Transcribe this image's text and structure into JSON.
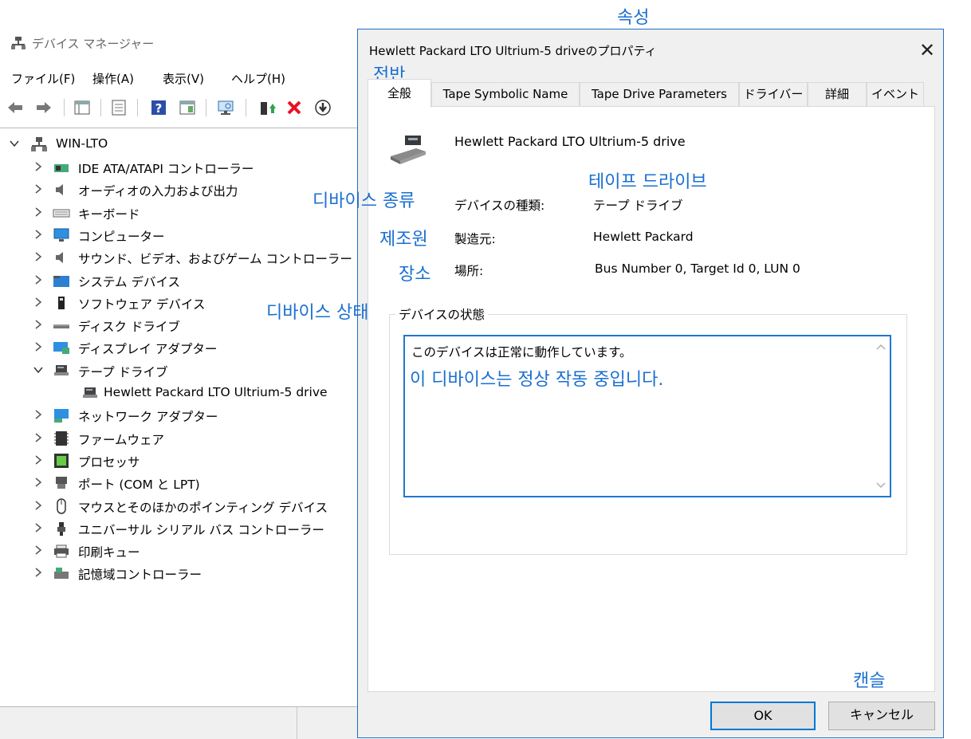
{
  "device_manager": {
    "title": "デバイス マネージャー",
    "menu": [
      "ファイル(F)",
      "操作(A)",
      "表示(V)",
      "ヘルプ(H)"
    ],
    "toolbar_icons": [
      "back-arrow-icon",
      "forward-arrow-icon",
      "properties-grid-icon",
      "update-driver-icon",
      "help-icon",
      "action-view-icon",
      "scan-hardware-icon",
      "enable-device-icon",
      "uninstall-x-icon",
      "disable-device-icon"
    ],
    "tree": {
      "root": "WIN-LTO",
      "items": [
        {
          "label": "IDE ATA/ATAPI コントローラー",
          "icon": "ide-controller-icon"
        },
        {
          "label": "オーディオの入力および出力",
          "icon": "speaker-icon"
        },
        {
          "label": "キーボード",
          "icon": "keyboard-icon"
        },
        {
          "label": "コンピューター",
          "icon": "monitor-icon"
        },
        {
          "label": "サウンド、ビデオ、およびゲーム コントローラー",
          "icon": "speaker-icon"
        },
        {
          "label": "システム デバイス",
          "icon": "system-folder-icon"
        },
        {
          "label": "ソフトウェア デバイス",
          "icon": "software-device-icon"
        },
        {
          "label": "ディスク ドライブ",
          "icon": "disk-drive-icon"
        },
        {
          "label": "ディスプレイ アダプター",
          "icon": "display-adapter-icon"
        },
        {
          "label": "テープ ドライブ",
          "icon": "tape-drive-icon",
          "expanded": true
        },
        {
          "label": "Hewlett Packard LTO Ultrium-5 drive",
          "icon": "tape-drive-icon",
          "child": true
        },
        {
          "label": "ネットワーク アダプター",
          "icon": "network-adapter-icon"
        },
        {
          "label": "ファームウェア",
          "icon": "firmware-chip-icon"
        },
        {
          "label": "プロセッサ",
          "icon": "processor-icon"
        },
        {
          "label": "ポート (COM と LPT)",
          "icon": "port-icon"
        },
        {
          "label": "マウスとそのほかのポインティング デバイス",
          "icon": "mouse-icon"
        },
        {
          "label": "ユニバーサル シリアル バス コントローラー",
          "icon": "usb-icon"
        },
        {
          "label": "印刷キュー",
          "icon": "printer-icon"
        },
        {
          "label": "記憶域コントローラー",
          "icon": "storage-controller-icon"
        }
      ]
    }
  },
  "dialog": {
    "title": "Hewlett Packard LTO Ultrium-5 driveのプロパティ",
    "tabs": [
      "全般",
      "Tape Symbolic Name",
      "Tape Drive Parameters",
      "ドライバー",
      "詳細",
      "イベント"
    ],
    "active_tab": "全般",
    "device_name": "Hewlett Packard LTO Ultrium-5 drive",
    "props": {
      "type_label": "デバイスの種類:",
      "type_value": "テープ ドライブ",
      "manufacturer_label": "製造元:",
      "manufacturer_value": "Hewlett Packard",
      "location_label": "場所:",
      "location_value": "Bus Number 0, Target Id 0, LUN 0"
    },
    "status_legend": "デバイスの状態",
    "status_text": "このデバイスは正常に動作しています。",
    "ok_label": "OK",
    "cancel_label": "キャンセル"
  },
  "annotations": {
    "properties": "속성",
    "general": "전반",
    "tape_drive": "테이프 드라이브",
    "device_type": "디바이스 종류",
    "manufacturer": "제조원",
    "location": "장소",
    "device_status": "디바이스 상태",
    "status_translation": "이 디바이스는 정상 작동 중입니다.",
    "cancel": "캔슬"
  },
  "colors": {
    "accent": "#1e6fc6",
    "annotation": "#1a6fd0",
    "uninstall_red": "#e81123"
  }
}
